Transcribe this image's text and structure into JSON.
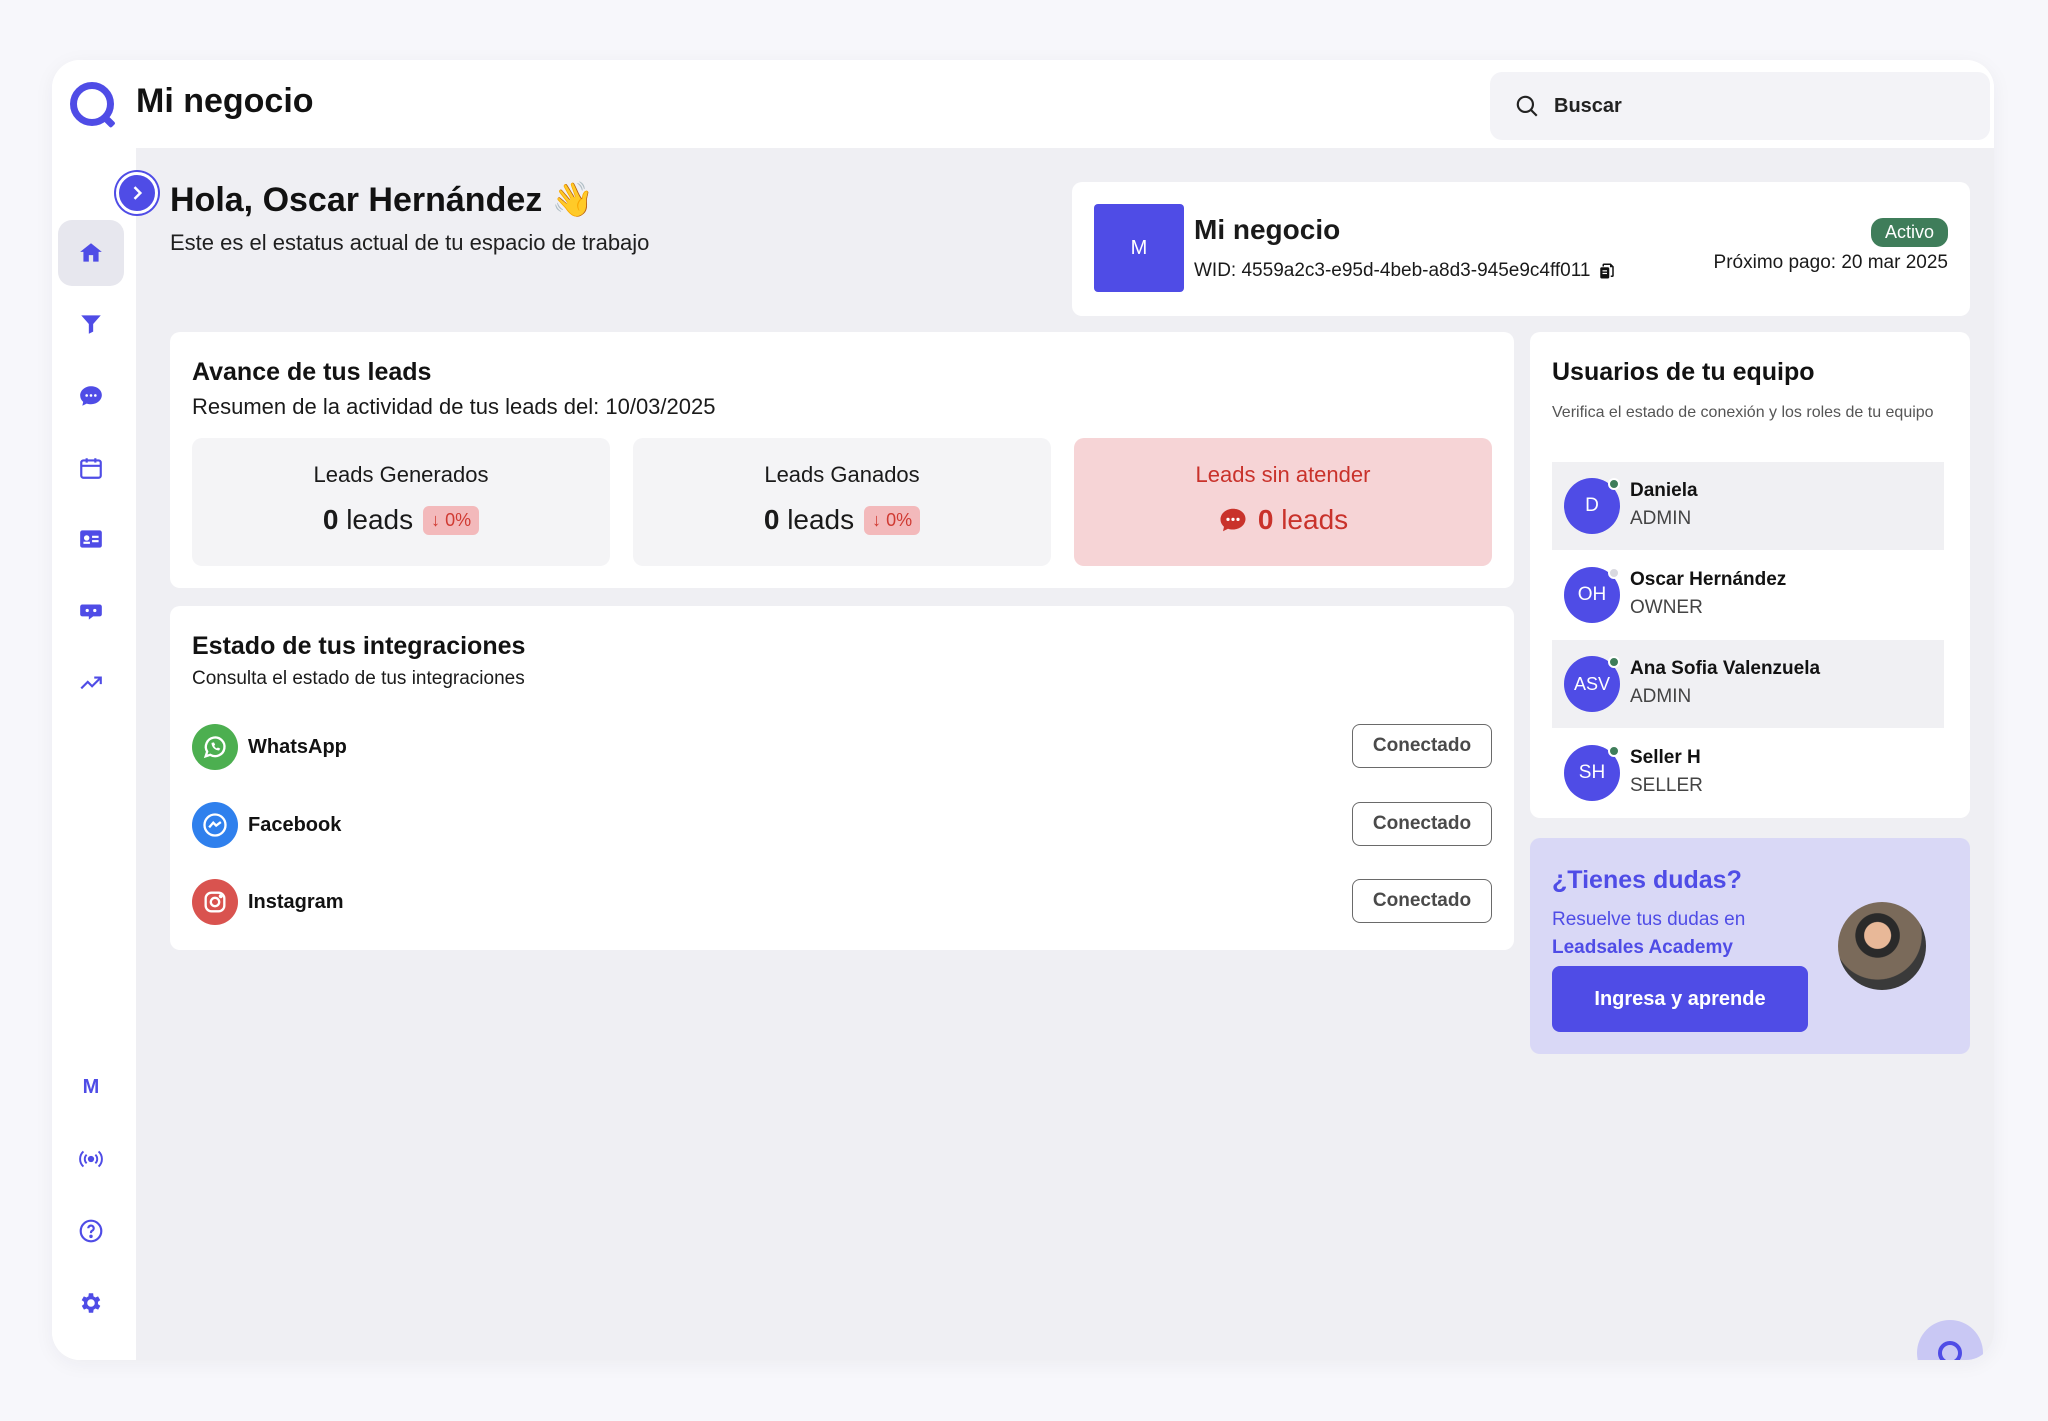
{
  "header": {
    "title": "Mi negocio",
    "search_label": "Buscar"
  },
  "sidebar": {
    "items": [
      {
        "name": "home-icon"
      },
      {
        "name": "funnel-icon"
      },
      {
        "name": "chat-icon"
      },
      {
        "name": "calendar-icon"
      },
      {
        "name": "contact-card-icon"
      },
      {
        "name": "bot-icon"
      },
      {
        "name": "trend-icon"
      }
    ],
    "workspace_letter": "M",
    "bottom_items": [
      {
        "name": "broadcast-icon"
      },
      {
        "name": "help-icon"
      },
      {
        "name": "settings-icon"
      }
    ]
  },
  "greeting": {
    "title": "Hola, Oscar Hernández 👋",
    "subtitle": "Este es el estatus actual de tu espacio de trabajo"
  },
  "business": {
    "avatar_letter": "M",
    "name": "Mi negocio",
    "wid": "WID: 4559a2c3-e95d-4beb-a8d3-945e9c4ff011",
    "status": "Activo",
    "next_payment": "Próximo pago: 20 mar 2025"
  },
  "leads": {
    "title": "Avance de tus leads",
    "subtitle": "Resumen de la actividad de tus leads del: 10/03/2025",
    "generated": {
      "label": "Leads Generados",
      "count": "0",
      "unit": "leads",
      "change": "↓ 0%"
    },
    "won": {
      "label": "Leads Ganados",
      "count": "0",
      "unit": "leads",
      "change": "↓ 0%"
    },
    "unattended": {
      "label": "Leads sin atender",
      "count": "0",
      "unit": "leads"
    }
  },
  "integrations": {
    "title": "Estado de tus integraciones",
    "subtitle": "Consulta el estado de tus integraciones",
    "items": [
      {
        "name": "WhatsApp",
        "status": "Conectado",
        "color": "#4caf50"
      },
      {
        "name": "Facebook",
        "status": "Conectado",
        "color": "#2f80ed"
      },
      {
        "name": "Instagram",
        "status": "Conectado",
        "color": "#d9534f"
      }
    ]
  },
  "team": {
    "title": "Usuarios de tu equipo",
    "subtitle": "Verifica el estado de conexión y los roles de tu equipo",
    "members": [
      {
        "initials": "D",
        "name": "Daniela",
        "role": "ADMIN",
        "online": true
      },
      {
        "initials": "OH",
        "name": "Oscar Hernández",
        "role": "OWNER",
        "online": false
      },
      {
        "initials": "ASV",
        "name": "Ana Sofia Valenzuela",
        "role": "ADMIN",
        "online": true
      },
      {
        "initials": "SH",
        "name": "Seller H",
        "role": "SELLER",
        "online": true
      }
    ]
  },
  "help": {
    "title": "¿Tienes dudas?",
    "text": "Resuelve tus dudas en",
    "link": "Leadsales Academy",
    "button": "Ingresa y aprende"
  },
  "colors": {
    "accent": "#4f4ce6",
    "active_badge": "#3f7d5a",
    "alert": "#c9322b"
  }
}
